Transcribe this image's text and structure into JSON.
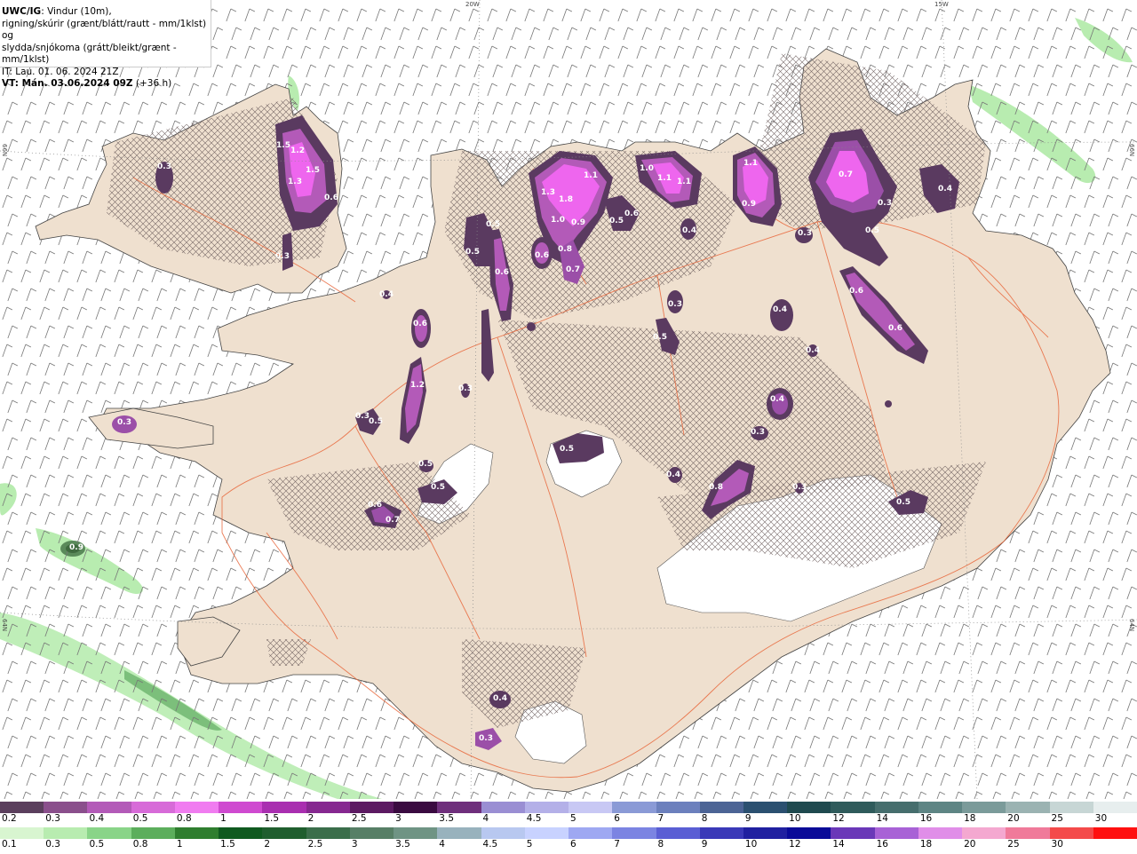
{
  "header": {
    "title_bold": "UWC/IG",
    "title_rest": ": Vindur (10m),",
    "line2": "rigning/skúrir (grænt/blátt/rautt - mm/1klst) og",
    "line3": "slydda/snjókoma (grátt/bleikt/grænt - mm/1klst)",
    "line4": "IT: Lau. 01. 06. 2024 21Z",
    "line5_bold": "VT: Mán. 03.06.2024 09Z",
    "line5_rest": " (+36 h)"
  },
  "grid_labels": {
    "lon_20w": "20W",
    "lon_15w": "15W",
    "lat_66n_left": "66N",
    "lat_66n_right": "66N",
    "lat_64n_left": "64N",
    "lat_64n_right": "64N"
  },
  "colors": {
    "land": "#efe0cf",
    "water": "#ffffff",
    "roads": "#e8663a",
    "snow_dark": "#5a3a60",
    "snow_mid": "#9b4fa8",
    "snow_bright": "#ee66ee",
    "rain_light": "#b8ecb0",
    "rain_mid": "#6bb36b"
  },
  "precip_labels": [
    {
      "v": "1.5"
    },
    {
      "v": "1.2"
    },
    {
      "v": "1.5"
    },
    {
      "v": "1.3"
    },
    {
      "v": "0.6"
    },
    {
      "v": "0.3"
    },
    {
      "v": "0.3"
    },
    {
      "v": "0.5"
    },
    {
      "v": "0.6"
    },
    {
      "v": "0.5"
    },
    {
      "v": "1.3"
    },
    {
      "v": "1.8"
    },
    {
      "v": "1.1"
    },
    {
      "v": "1.0"
    },
    {
      "v": "0.9"
    },
    {
      "v": "0.8"
    },
    {
      "v": "0.7"
    },
    {
      "v": "0.6"
    },
    {
      "v": "0.5"
    },
    {
      "v": "0.6"
    },
    {
      "v": "1.0"
    },
    {
      "v": "1.1"
    },
    {
      "v": "1.1"
    },
    {
      "v": "0.4"
    },
    {
      "v": "1.1"
    },
    {
      "v": "0.9"
    },
    {
      "v": "0.7"
    },
    {
      "v": "0.3"
    },
    {
      "v": "0.4"
    },
    {
      "v": "0.5"
    },
    {
      "v": "0.3"
    },
    {
      "v": "0.6"
    },
    {
      "v": "0.6"
    },
    {
      "v": "0.3"
    },
    {
      "v": "0.4"
    },
    {
      "v": "0.5"
    },
    {
      "v": "0.4"
    },
    {
      "v": "0.6"
    },
    {
      "v": "1.2"
    },
    {
      "v": "0.3"
    },
    {
      "v": "0.3"
    },
    {
      "v": "0.5"
    },
    {
      "v": "0.5"
    },
    {
      "v": "0.5"
    },
    {
      "v": "0.6"
    },
    {
      "v": "0.7"
    },
    {
      "v": "0.5"
    },
    {
      "v": "0.4"
    },
    {
      "v": "0.8"
    },
    {
      "v": "0.3"
    },
    {
      "v": "0.4"
    },
    {
      "v": "0.5"
    },
    {
      "v": "0.3"
    },
    {
      "v": "0.9"
    },
    {
      "v": "0.4"
    },
    {
      "v": "0.3"
    },
    {
      "v": "0.3"
    },
    {
      "v": "0.4"
    }
  ],
  "scale_snow": {
    "labels": [
      "0.2",
      "0.3",
      "0.4",
      "0.5",
      "0.8",
      "1",
      "1.5",
      "2",
      "2.5",
      "3",
      "3.5",
      "4",
      "4.5",
      "5",
      "6",
      "7",
      "8",
      "9",
      "10",
      "12",
      "14",
      "16",
      "18",
      "20",
      "25",
      "30"
    ],
    "colors": [
      "#5b3f5d",
      "#8a4f8c",
      "#b35ab8",
      "#d76bd8",
      "#f07cf0",
      "#cf4ad0",
      "#a92fb0",
      "#862890",
      "#5c1a62",
      "#3a0a40",
      "#6f2f7c",
      "#9a8ed3",
      "#b4b0e8",
      "#c8c8f4",
      "#8a9ad6",
      "#6c80bd",
      "#4c6495",
      "#2b5070",
      "#1f4a4f",
      "#2f5b5b",
      "#466e6d",
      "#5e8584",
      "#7b9b9a",
      "#9bb3b2",
      "#c7d6d5",
      "#e7eeee"
    ]
  },
  "scale_rain": {
    "labels": [
      "0.1",
      "0.3",
      "0.5",
      "0.8",
      "1",
      "1.5",
      "2",
      "2.5",
      "3",
      "3.5",
      "4",
      "4.5",
      "5",
      "6",
      "7",
      "8",
      "9",
      "10",
      "12",
      "14",
      "16",
      "18",
      "20",
      "25",
      "30"
    ],
    "colors": [
      "#d8f5d0",
      "#b8ecb0",
      "#89d488",
      "#5cae5c",
      "#2f7e2f",
      "#0f5a1f",
      "#1f5e2e",
      "#3a6e4a",
      "#577f66",
      "#6f9484",
      "#98b2bd",
      "#b8c8f0",
      "#c8d2ff",
      "#9ea8f2",
      "#7b84e2",
      "#5a5ed4",
      "#3a39b8",
      "#2020a0",
      "#0a0a98",
      "#6a38b8",
      "#a862d6",
      "#e08ee8",
      "#f4a8d0",
      "#f07a9a",
      "#f44a4a",
      "#ff1010"
    ]
  }
}
